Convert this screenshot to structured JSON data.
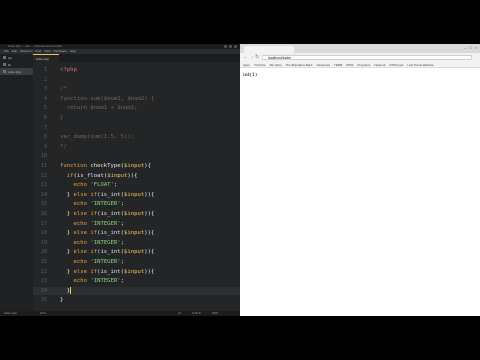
{
  "editor": {
    "title": "index.php — ide — /home/username/dev",
    "menu": [
      "File",
      "Edit",
      "Selection",
      "Find",
      "View",
      "Packages",
      "Help"
    ],
    "sidebar": [
      {
        "label": "ide",
        "active": false
      },
      {
        "label": "lib",
        "active": false
      },
      {
        "label": "index.php",
        "active": true
      }
    ],
    "tab_label": "index.php",
    "status": {
      "left": "index.php",
      "pos": "24:5",
      "right_1": "LF",
      "right_2": "UTF-8",
      "right_3": "PHP"
    },
    "lines": [
      {
        "n": "1",
        "html": "<span class='t-tag'>&lt;?php</span>"
      },
      {
        "n": "2",
        "html": ""
      },
      {
        "n": "3",
        "html": "<span class='t-cm'>/*</span>"
      },
      {
        "n": "4",
        "html": "<span class='t-cm'>function sum($num1, $num2) {</span>"
      },
      {
        "n": "5",
        "html": "<span class='t-cm'>  return $num1 + $num2;</span>"
      },
      {
        "n": "6",
        "html": "<span class='t-cm'>}</span>"
      },
      {
        "n": "7",
        "html": ""
      },
      {
        "n": "8",
        "html": "<span class='t-cm'>var_dump(sum(1.5, 5));</span>"
      },
      {
        "n": "9",
        "html": "<span class='t-cm'>*/</span>"
      },
      {
        "n": "10",
        "html": ""
      },
      {
        "n": "11",
        "html": "<span class='t-kw'>function</span> <span class='t-fn'>checkType</span>(<span class='t-var'>$input</span>){"
      },
      {
        "n": "12",
        "html": "  <span class='t-kw'>if</span>(<span class='t-fn'>is_float</span>(<span class='t-var'>$input</span>)){"
      },
      {
        "n": "13",
        "html": "    <span class='t-kw'>echo</span> <span class='t-str'>'FLOAT'</span>;"
      },
      {
        "n": "14",
        "html": "  } <span class='t-kw'>else if</span>(<span class='t-fn'>is_int</span>(<span class='t-var'>$input</span>)){"
      },
      {
        "n": "15",
        "html": "    <span class='t-kw'>echo</span> <span class='t-str'>'INTEGER'</span>;"
      },
      {
        "n": "16",
        "html": "  } <span class='t-kw'>else if</span>(<span class='t-fn'>is_int</span>(<span class='t-var'>$input</span>)){"
      },
      {
        "n": "17",
        "html": "    <span class='t-kw'>echo</span> <span class='t-str'>'INTEGER'</span>;"
      },
      {
        "n": "18",
        "html": "  } <span class='t-kw'>else if</span>(<span class='t-fn'>is_int</span>(<span class='t-var'>$input</span>)){"
      },
      {
        "n": "19",
        "html": "    <span class='t-kw'>echo</span> <span class='t-str'>'INTEGER'</span>;"
      },
      {
        "n": "20",
        "html": "  } <span class='t-kw'>else if</span>(<span class='t-fn'>is_int</span>(<span class='t-var'>$input</span>)){"
      },
      {
        "n": "21",
        "html": "    <span class='t-kw'>echo</span> <span class='t-str'>'INTEGER'</span>;"
      },
      {
        "n": "22",
        "html": "  } <span class='t-kw'>else if</span>(<span class='t-fn'>is_int</span>(<span class='t-var'>$input</span>)){"
      },
      {
        "n": "23",
        "html": "    <span class='t-kw'>echo</span> <span class='t-str'>'INTEGER'</span>;"
      },
      {
        "n": "24",
        "html": "  }<span class='caret'></span>",
        "current": true
      },
      {
        "n": "25",
        "html": "}"
      }
    ]
  },
  "browser": {
    "tab_title": "localhost/index",
    "url": "localhost/index",
    "bookmarks": [
      "Apps",
      "YouTube",
      "Bet Slots",
      "The Brandless Bank",
      "Facebook",
      "TERM",
      "IRSS",
      "Programs",
      "Network",
      "RSS Feed",
      "Lost Travel Website"
    ],
    "output": "int(1)"
  }
}
